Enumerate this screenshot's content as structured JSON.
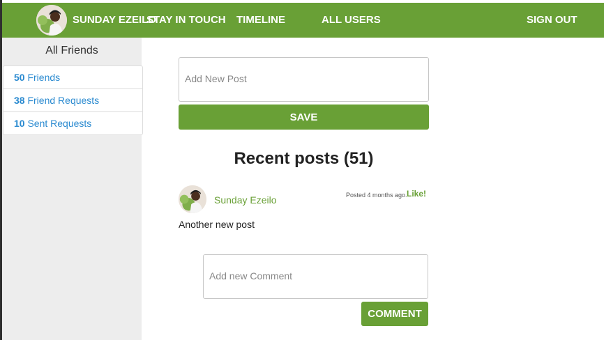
{
  "navbar": {
    "brand_label": "SUNDAY EZEILO",
    "stay_in_touch_label": "STAY IN TOUCH",
    "timeline_label": "TIMELINE",
    "all_users_label": "ALL USERS",
    "sign_out_label": "SIGN OUT",
    "avatar_icon": "user-avatar"
  },
  "sidebar": {
    "title": "All Friends",
    "items": [
      {
        "count": "50",
        "label": "Friends"
      },
      {
        "count": "38",
        "label": "Friend Requests"
      },
      {
        "count": "10",
        "label": "Sent Requests"
      }
    ]
  },
  "new_post": {
    "placeholder": "Add New Post",
    "save_label": "SAVE"
  },
  "feed": {
    "title": "Recent posts (51)",
    "posts": [
      {
        "author": "Sunday Ezeilo",
        "meta": "Posted 4 months ago.",
        "like_label": "Like!",
        "body": "Another new post",
        "comment_placeholder": "Add new Comment",
        "comment_label": "COMMENT"
      }
    ]
  },
  "colors": {
    "brand_green": "#69a036",
    "link_blue": "#2a8ad0",
    "sidebar_bg": "#ededed"
  }
}
